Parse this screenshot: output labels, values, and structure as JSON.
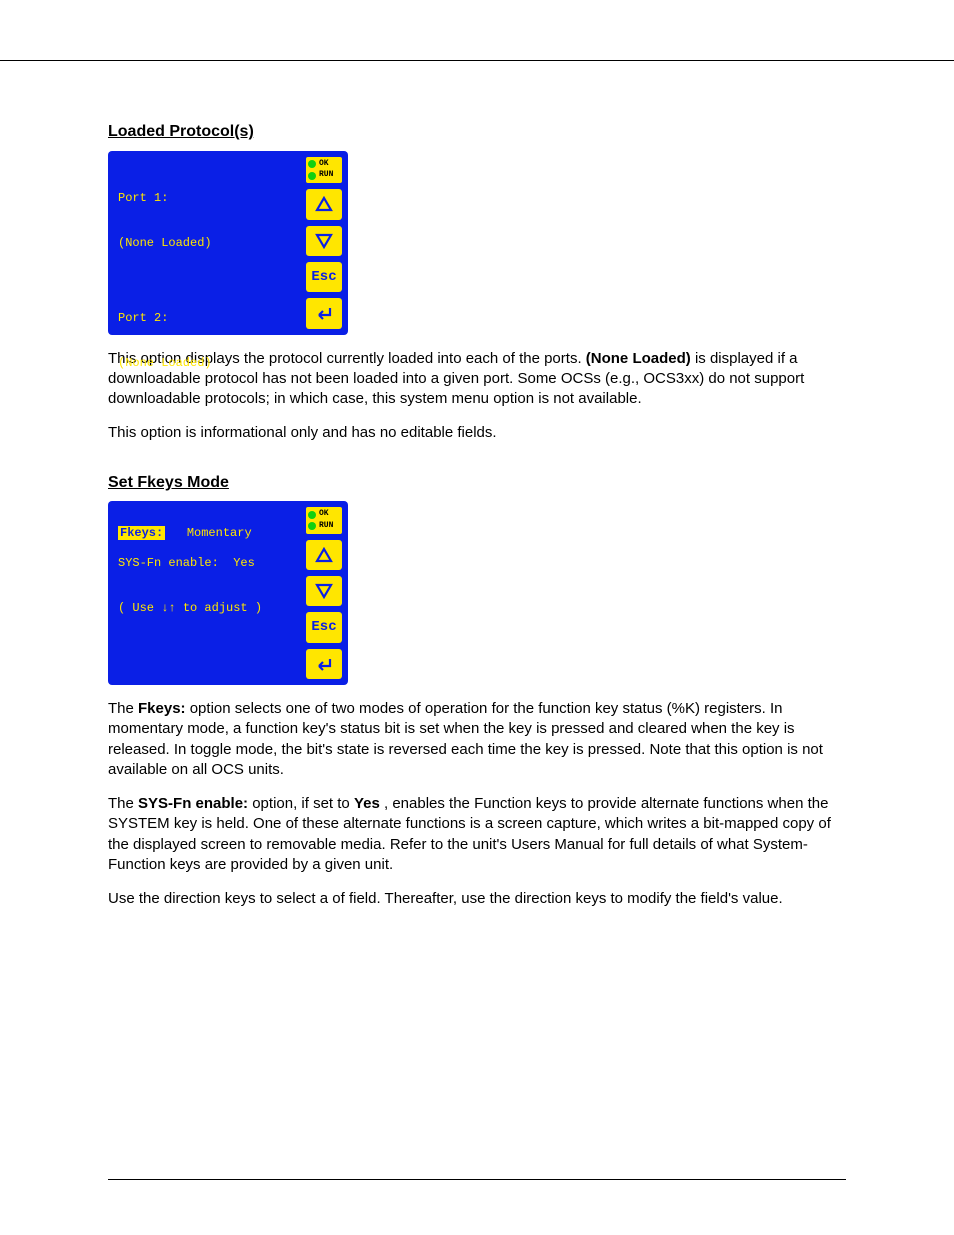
{
  "header": {
    "left": "",
    "right": ""
  },
  "footer": {
    "left": "",
    "center": "",
    "pageNumber": ""
  },
  "loadedProtocols": {
    "label": "Loaded Protocol(s)",
    "lcd": {
      "line1": "Port 1:",
      "line2": "(None Loaded)",
      "blank1": "",
      "line3": "Port 2:",
      "line4": "(None Loaded)"
    },
    "description1_a": "This option displays the protocol currently loaded into each of the ports. ",
    "description1_b": "(None Loaded)",
    "description1_c": " is displayed if a downloadable protocol has not been loaded into a given port. Some OCSs (e.g., OCS3xx) do not support downloadable protocols; in which case, this system menu option is not available.",
    "description2": "This option is informational only and has no editable fields."
  },
  "functionKeys": {
    "label": "Set Fkeys Mode",
    "lcd": {
      "row1_label": "Fkeys:",
      "row1_value": "Momentary",
      "row2_label": "SYS-Fn enable:",
      "row2_value": "Yes",
      "hint_open": "( Use ",
      "hint_arrows": "↓↑",
      "hint_close": " to adjust )"
    },
    "para_a_prefix": "The ",
    "para_a_bold": "Fkeys:",
    "para_a_rest": " option selects one of two modes of operation for the function key status (%K) registers. In momentary mode, a function key's status bit is set when the key is pressed and cleared when the key is released. In toggle mode, the bit's state is reversed each time the key is pressed. Note that this option is not available on all OCS units.",
    "para_b_prefix": "The ",
    "para_b_bold": "SYS-Fn enable:",
    "para_b_rest_1": " option, if set to ",
    "para_b_bold2": "Yes",
    "para_b_rest_2": ", enables the Function keys to provide alternate functions when the SYSTEM key is held. One of these alternate functions is a screen capture, which writes a bit-mapped copy of the displayed screen to removable media. Refer to the unit's Users Manual for full details of what System-Function keys are provided by a given unit.",
    "para_c_prefix": "Use the direction keys to select a of field. Thereafter, use the ",
    "para_c_word": "direction",
    "para_c_rest": " keys to modify the field's value."
  },
  "device": {
    "leds": {
      "ok": "OK",
      "run": "RUN"
    },
    "buttons": {
      "up": "up-arrow",
      "down": "down-arrow",
      "esc": "Esc",
      "enter": "enter"
    }
  }
}
